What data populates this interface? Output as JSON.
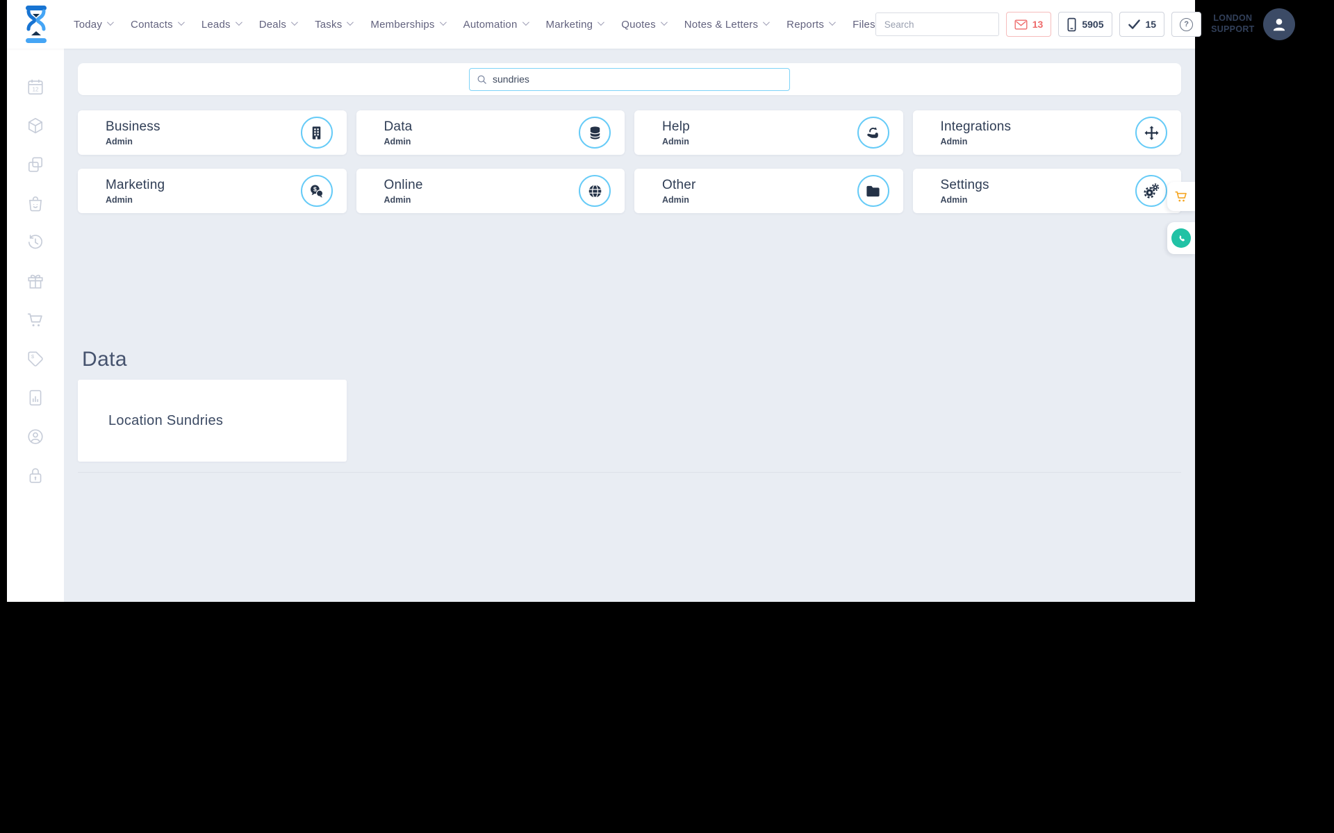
{
  "topbar": {
    "nav": [
      {
        "label": "Today"
      },
      {
        "label": "Contacts"
      },
      {
        "label": "Leads"
      },
      {
        "label": "Deals"
      },
      {
        "label": "Tasks"
      },
      {
        "label": "Memberships"
      },
      {
        "label": "Automation"
      },
      {
        "label": "Marketing"
      },
      {
        "label": "Quotes"
      },
      {
        "label": "Notes & Letters"
      },
      {
        "label": "Reports"
      },
      {
        "label": "Files"
      }
    ],
    "search": {
      "placeholder": "Search"
    },
    "mail_count": "13",
    "phone_count": "5905",
    "task_count": "15",
    "help_label": "?",
    "user": {
      "line1": "LONDON",
      "line2": "SUPPORT"
    }
  },
  "sidebar": {
    "calendar_day": "12",
    "icons": [
      "calendar",
      "box",
      "copy",
      "shopping-bag",
      "history",
      "gift",
      "cart",
      "price-tag",
      "report",
      "account",
      "lock"
    ]
  },
  "content": {
    "search_value": "sundries",
    "cards": [
      {
        "title": "Business",
        "subtitle": "Admin",
        "icon": "building"
      },
      {
        "title": "Data",
        "subtitle": "Admin",
        "icon": "database"
      },
      {
        "title": "Help",
        "subtitle": "Admin",
        "icon": "hands-helping"
      },
      {
        "title": "Integrations",
        "subtitle": "Admin",
        "icon": "arrows-move"
      },
      {
        "title": "Marketing",
        "subtitle": "Admin",
        "icon": "comments-dollar"
      },
      {
        "title": "Online",
        "subtitle": "Admin",
        "icon": "globe"
      },
      {
        "title": "Other",
        "subtitle": "Admin",
        "icon": "folder"
      },
      {
        "title": "Settings",
        "subtitle": "Admin",
        "icon": "gears"
      }
    ],
    "section": {
      "title": "Data",
      "items": [
        {
          "label": "Location Sundries"
        }
      ]
    }
  },
  "colors": {
    "accent_blue": "#66cbf7",
    "navy": "#243247",
    "nav_text": "#62627e",
    "badge_red": "#ee6a6a",
    "cart_orange": "#f5a623",
    "whatsapp_green": "#21c2a5",
    "logo_blue": "#1874d2",
    "page_bg": "#e9edf3"
  }
}
